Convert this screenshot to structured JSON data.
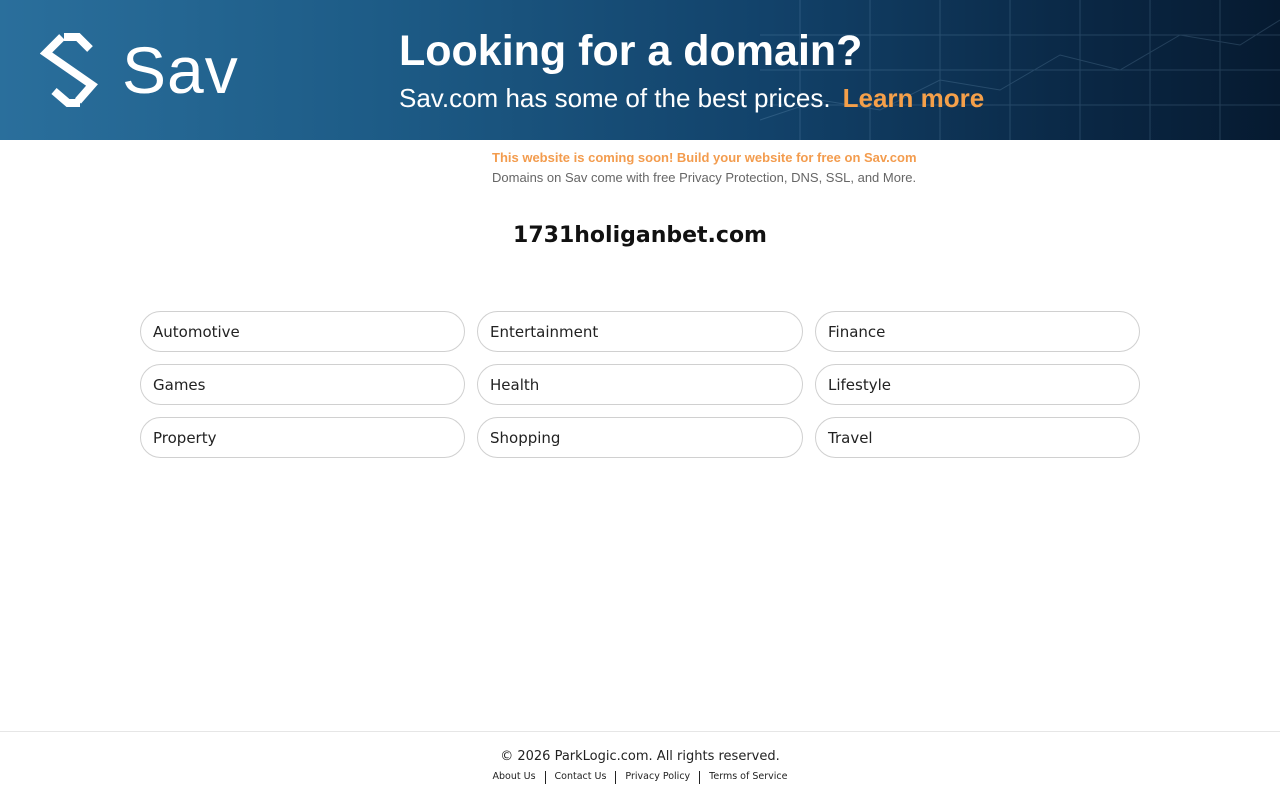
{
  "banner": {
    "logo_text": "Sav",
    "logo_icon": "sav-logo-icon",
    "headline": "Looking for a domain?",
    "subline": "Sav.com has some of the best prices.",
    "cta": "Learn more",
    "cta_color": "#f5a04a",
    "background_color": "#1d5b86"
  },
  "promo": {
    "line1": "This website is coming soon! Build your website for free on Sav.com",
    "line2": "Domains on Sav come with free Privacy Protection, DNS, SSL, and More.",
    "line1_color": "#f39c4e"
  },
  "domain": {
    "name": "1731holiganbet.com"
  },
  "categories": [
    {
      "label": "Automotive"
    },
    {
      "label": "Entertainment"
    },
    {
      "label": "Finance"
    },
    {
      "label": "Games"
    },
    {
      "label": "Health"
    },
    {
      "label": "Lifestyle"
    },
    {
      "label": "Property"
    },
    {
      "label": "Shopping"
    },
    {
      "label": "Travel"
    }
  ],
  "footer": {
    "copyright": "© 2026 ParkLogic.com. All rights reserved.",
    "links": [
      {
        "label": "About Us"
      },
      {
        "label": "Contact Us"
      },
      {
        "label": "Privacy Policy"
      },
      {
        "label": "Terms of Service"
      }
    ]
  }
}
